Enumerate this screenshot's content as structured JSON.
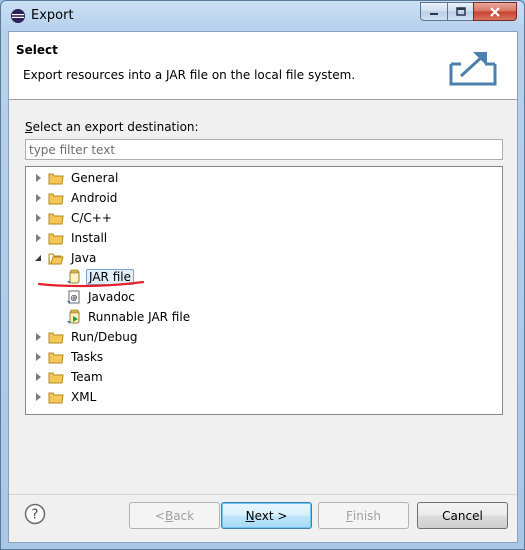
{
  "window": {
    "title": "Export"
  },
  "header": {
    "title": "Select",
    "description": "Export resources into a JAR file on the local file system."
  },
  "filter": {
    "label_pre": "",
    "label_accel": "S",
    "label_post": "elect an export destination:",
    "placeholder": "type filter text"
  },
  "tree": {
    "nodes": [
      {
        "label": "General",
        "state": "collapsed"
      },
      {
        "label": "Android",
        "state": "collapsed"
      },
      {
        "label": "C/C++",
        "state": "collapsed"
      },
      {
        "label": "Install",
        "state": "collapsed"
      },
      {
        "label": "Java",
        "state": "expanded"
      },
      {
        "label": "JAR file",
        "state": "leaf",
        "selected": true
      },
      {
        "label": "Javadoc",
        "state": "leaf"
      },
      {
        "label": "Runnable JAR file",
        "state": "leaf"
      },
      {
        "label": "Run/Debug",
        "state": "collapsed"
      },
      {
        "label": "Tasks",
        "state": "collapsed"
      },
      {
        "label": "Team",
        "state": "collapsed"
      },
      {
        "label": "XML",
        "state": "collapsed"
      }
    ]
  },
  "buttons": {
    "back_pre": "< ",
    "back_accel": "B",
    "back_post": "ack",
    "next_pre": "",
    "next_accel": "N",
    "next_post": "ext >",
    "finish_pre": "",
    "finish_accel": "F",
    "finish_post": "inish",
    "cancel": "Cancel"
  },
  "colors": {
    "selection_bg": "#e1effb",
    "annotation_red": "#e8202a",
    "folder_yellow": "#f4c758"
  }
}
